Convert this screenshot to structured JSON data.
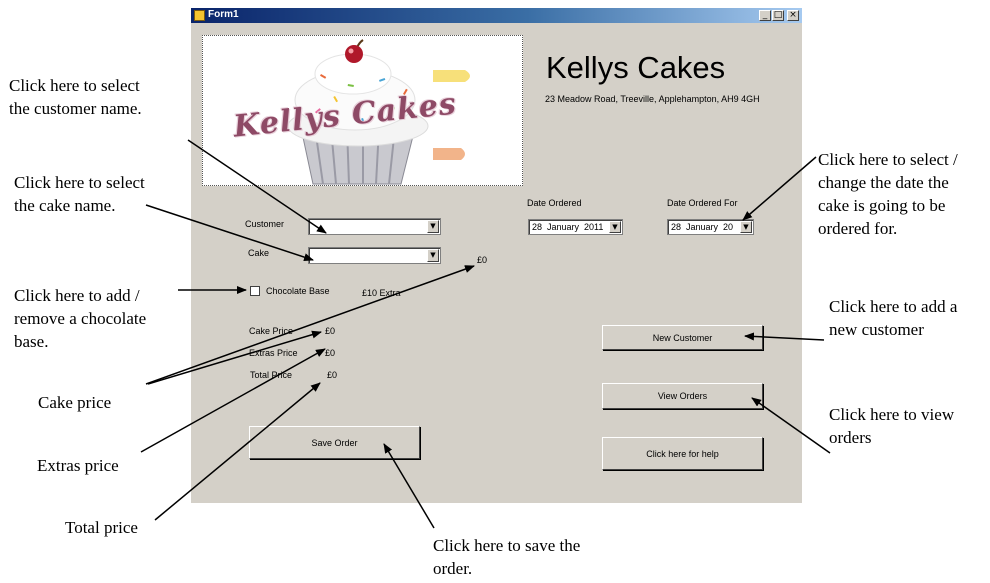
{
  "window": {
    "title": "Form1",
    "minimize_glyph": "_",
    "maximize_glyph": "□",
    "close_glyph": "×"
  },
  "header": {
    "app_title": "Kellys Cakes",
    "address": "23 Meadow Road, Treeville, Applehampton, AH9 4GH",
    "logo_text": "Kellys Cakes"
  },
  "form": {
    "customer_label": "Customer",
    "customer_value": "",
    "cake_label": "Cake",
    "cake_value": "",
    "cake_price_display": "£0",
    "chocolate_base_label": "Chocolate Base",
    "chocolate_base_checked": false,
    "chocolate_extra": "£10 Extra",
    "date_ordered_label": "Date Ordered",
    "date_ordered_value": "28  January  2011",
    "date_ordered_for_label": "Date Ordered For",
    "date_ordered_for_value": "28  January  20"
  },
  "prices": {
    "cake_price_label": "Cake Price",
    "cake_price_value": "£0",
    "extras_price_label": "Extras Price",
    "extras_price_value": "£0",
    "total_price_label": "Total Price",
    "total_price_value": "£0"
  },
  "buttons": {
    "save_order": "Save Order",
    "new_customer": "New Customer",
    "view_orders": "View Orders",
    "help": "Click here for help"
  },
  "annotations": {
    "select_customer": [
      "Click here to select",
      "the customer name."
    ],
    "select_cake": [
      "Click here to select",
      "the cake name."
    ],
    "chocolate_base": [
      "Click here to add /",
      "remove a chocolate",
      "base."
    ],
    "cake_price": "Cake price",
    "extras_price": "Extras price",
    "total_price": "Total price",
    "save_order": [
      "Click here to save the",
      "order."
    ],
    "change_date": [
      "Click here to select /",
      "change the date the",
      "cake is going to be",
      "ordered for."
    ],
    "new_customer": [
      "Click here to add a",
      "new customer"
    ],
    "view_orders": [
      "Click here to view",
      "orders"
    ]
  },
  "icons": {
    "app_icon": "form-icon",
    "dropdown": "chevron-down-icon"
  }
}
